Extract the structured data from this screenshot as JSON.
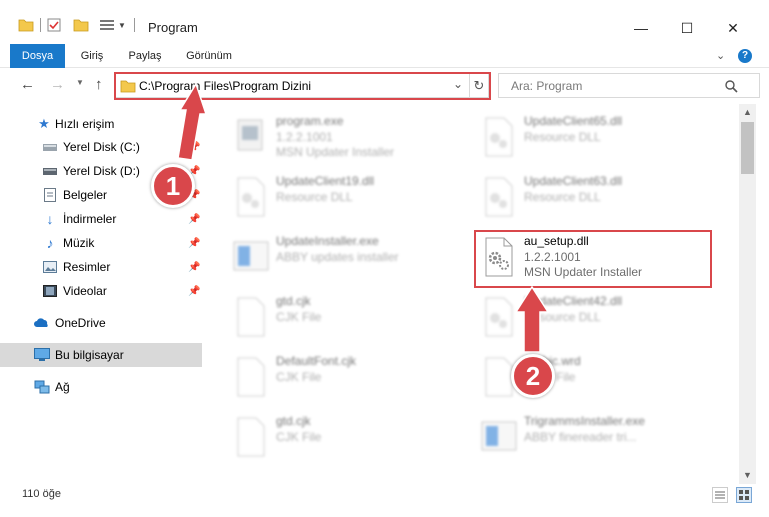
{
  "window": {
    "title": "Program",
    "minimize": "—",
    "maximize": "☐",
    "close": "✕"
  },
  "ribbon": {
    "tabs": [
      {
        "label": "Dosya",
        "active": true
      },
      {
        "label": "Giriş"
      },
      {
        "label": "Paylaş"
      },
      {
        "label": "Görünüm"
      }
    ]
  },
  "navigation": {
    "address": "C:\\Program Files\\Program Dizini",
    "search_placeholder": "Ara: Program"
  },
  "sidebar": {
    "quick_access": "Hızlı erişim",
    "items": [
      {
        "label": "Yerel Disk (C:)",
        "icon": "drive-icon",
        "pinned": true
      },
      {
        "label": "Yerel Disk (D:)",
        "icon": "drive-icon",
        "pinned": true
      },
      {
        "label": "Belgeler",
        "icon": "documents-icon",
        "pinned": true
      },
      {
        "label": "İndirmeler",
        "icon": "downloads-icon",
        "pinned": true
      },
      {
        "label": "Müzik",
        "icon": "music-icon",
        "pinned": true
      },
      {
        "label": "Resimler",
        "icon": "pictures-icon",
        "pinned": true
      },
      {
        "label": "Videolar",
        "icon": "videos-icon",
        "pinned": true
      }
    ],
    "onedrive": "OneDrive",
    "this_pc": "Bu bilgisayar",
    "network": "Ağ"
  },
  "files": [
    {
      "name": "program.exe",
      "line2": "1.2.2.1001",
      "line3": "MSN Updater Installer",
      "icon": "exe-icon",
      "blurred": true
    },
    {
      "name": "UpdateClient65.dll",
      "line2": "Resource DLL",
      "line3": "",
      "icon": "dll-icon",
      "blurred": true
    },
    {
      "name": "UpdateClient19.dll",
      "line2": "Resource DLL",
      "line3": "",
      "icon": "dll-icon",
      "blurred": true
    },
    {
      "name": "UpdateClient63.dll",
      "line2": "Resource DLL",
      "line3": "",
      "icon": "dll-icon",
      "blurred": true
    },
    {
      "name": "UpdateInstaller.exe",
      "line2": "ABBY updates installer",
      "line3": "",
      "icon": "installer-icon",
      "blurred": true
    },
    {
      "name": "au_setup.dll",
      "line2": "1.2.2.1001",
      "line3": "MSN Updater Installer",
      "icon": "dll-icon",
      "blurred": false
    },
    {
      "name": "gtd.cjk",
      "line2": "CJK File",
      "line3": "",
      "icon": "file-icon",
      "blurred": true
    },
    {
      "name": "UpdateClient42.dll",
      "line2": "Resource DLL",
      "line3": "",
      "icon": "dll-icon",
      "blurred": true
    },
    {
      "name": "DefaultFont.cjk",
      "line2": "CJK File",
      "line3": "",
      "icon": "file-icon",
      "blurred": true
    },
    {
      "name": "Arabic.wrd",
      "line2": "WRD File",
      "line3": "",
      "icon": "file-icon",
      "blurred": true
    },
    {
      "name": "gtd.cjk",
      "line2": "CJK File",
      "line3": "",
      "icon": "file-icon",
      "blurred": true
    },
    {
      "name": "TrigrammsInstaller.exe",
      "line2": "ABBY finereader tri...",
      "line3": "",
      "icon": "installer-icon",
      "blurred": true
    }
  ],
  "status": {
    "item_count": "110 öğe"
  },
  "annotations": {
    "step1": "1",
    "step2": "2",
    "color": "#d9474b"
  }
}
